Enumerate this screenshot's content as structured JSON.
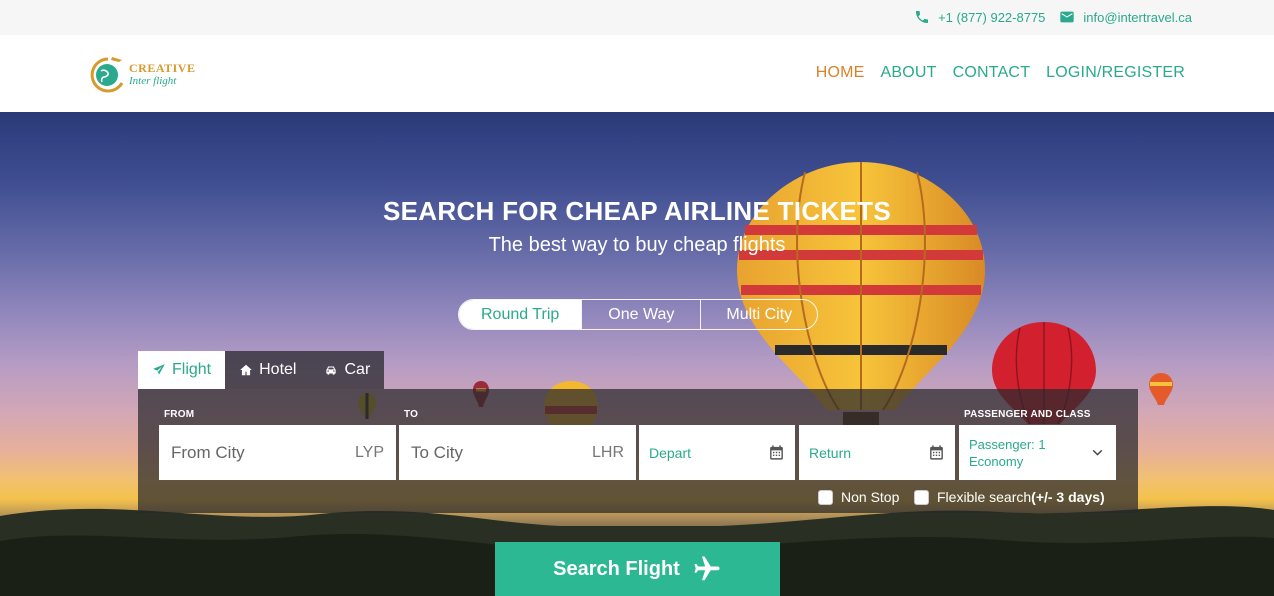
{
  "topbar": {
    "phone": "+1 (877) 922-8775",
    "email": "info@intertravel.ca"
  },
  "logo": {
    "line1": "CREATIVE",
    "line2": "Inter flight"
  },
  "nav": {
    "items": [
      {
        "label": "HOME",
        "active": true
      },
      {
        "label": "ABOUT",
        "active": false
      },
      {
        "label": "CONTACT",
        "active": false
      },
      {
        "label": "LOGIN/REGISTER",
        "active": false
      }
    ]
  },
  "hero": {
    "title": "SEARCH FOR CHEAP AIRLINE TICKETS",
    "subtitle": "The best way to buy cheap flights"
  },
  "trip_types": [
    "Round Trip",
    "One Way",
    "Multi City"
  ],
  "selected_trip_type": "Round Trip",
  "tabs": [
    {
      "label": "Flight",
      "icon": "paper-plane-icon",
      "active": true
    },
    {
      "label": "Hotel",
      "icon": "home-icon",
      "active": false
    },
    {
      "label": "Car",
      "icon": "car-icon",
      "active": false
    }
  ],
  "form": {
    "from_label": "FROM",
    "from_placeholder": "From City",
    "from_code": "LYP",
    "to_label": "TO",
    "to_placeholder": "To City",
    "to_code": "LHR",
    "depart_placeholder": "Depart",
    "return_placeholder": "Return",
    "pax_label": "PASSENGER AND CLASS",
    "pax_line1": "Passenger: 1",
    "pax_line2": "Economy",
    "nonstop_label": "Non Stop",
    "flexible_label": "Flexible search",
    "flexible_suffix": "(+/- 3 days)"
  },
  "search_button": "Search Flight",
  "colors": {
    "accent": "#2aa98d",
    "nav_active": "#d9822b",
    "button": "#2bb893"
  }
}
